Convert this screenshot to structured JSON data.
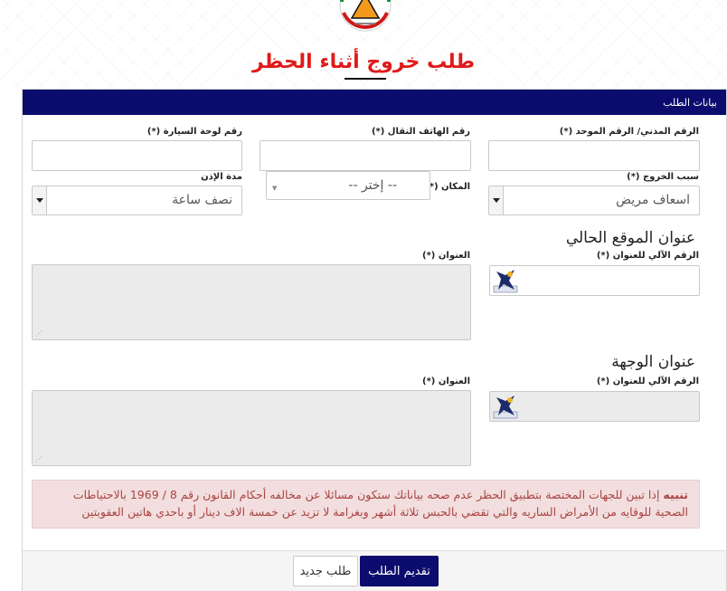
{
  "title": "طلب خروج أثناء الحظر",
  "panel": {
    "header": "بيانات الطلب"
  },
  "fields": {
    "civil_id_label": "الرقم المدني/ الرقم الموحد (*)",
    "mobile_label": "رقم الهاتف النقال (*)",
    "plate_label": "رقم لوحة السيارة (*)",
    "exit_reason_label": "سبب الخروج (*)",
    "exit_reason_value": "اسعاف مريض",
    "place_label": "المكان (*)",
    "place_value": "-- إختر --",
    "duration_label": "مدة الإذن",
    "duration_value": "نصف ساعة"
  },
  "current_location": {
    "heading": "عنوان الموقع الحالي",
    "auto_number_label": "الرقم الآلي للعنوان (*)",
    "address_label": "العنوان (*)"
  },
  "destination": {
    "heading": "عنوان الوجهة",
    "auto_number_label": "الرقم الآلي للعنوان (*)",
    "address_label": "العنوان (*)"
  },
  "alert": {
    "prefix": "تنبيه",
    "message": "إذا تبين للجهات المختصة بتطبيق الحظر عدم صحه بياناتك ستكون مسائلا عن مخالفه أحكام القانون رقم 8 / 1969 بالاحتياطات الصحية للوقايه من الأمراض الساريه والتي تقضي بالحبس ثلاثة أشهر وبغرامة لا تزيد عن خمسة الاف دينار أو باحدي هاتين العقوبتين"
  },
  "buttons": {
    "submit": "تقديم الطلب",
    "new_request": "طلب جديد"
  },
  "colors": {
    "primary": "#0c0c6e",
    "title": "#e01a1a",
    "alert_bg": "#f2dede",
    "alert_text": "#a94442"
  },
  "icons": {
    "logo": "kuwait-emblem-logo",
    "address_lookup": "address-lookup-icon"
  }
}
